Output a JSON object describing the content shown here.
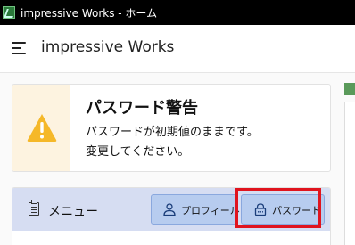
{
  "window": {
    "title": "impressive Works - ホーム",
    "app_icon": "app-logo-icon"
  },
  "header": {
    "menu_icon": "hamburger-menu-icon",
    "app_title": "impressive Works"
  },
  "warning": {
    "icon": "warning-triangle-icon",
    "title": "パスワード警告",
    "message_line1": "パスワードが初期値のままです。",
    "message_line2": "変更してください。",
    "colors": {
      "icon": "#f5b829",
      "icon_bg": "#fdf3e0"
    }
  },
  "menu": {
    "icon": "clipboard-icon",
    "label": "メニュー",
    "buttons": [
      {
        "label": "プロフィール",
        "icon": "person-icon"
      },
      {
        "label": "パスワード",
        "icon": "lock-icon"
      }
    ],
    "colors": {
      "header_bg": "#d6ddf2",
      "button_bg": "#b7ccef",
      "highlight": "#e0141e"
    }
  }
}
